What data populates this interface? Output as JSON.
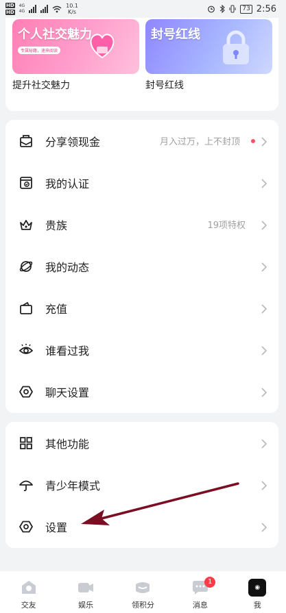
{
  "status_bar": {
    "hd_top": "HD",
    "hd_bottom": "HD",
    "net_top": "4G",
    "net_bottom": "4G",
    "speed_value": "10.1",
    "speed_unit": "K/s",
    "battery": "73",
    "time": "2:56"
  },
  "banners": [
    {
      "title": "个人社交魅力",
      "pill": "专属秘籍，速来阅读",
      "caption": "提升社交魅力"
    },
    {
      "title": "封号红线",
      "caption": "封号红线"
    }
  ],
  "menu_group_1": [
    {
      "icon": "envelope-icon",
      "label": "分享领现金",
      "extra": "月入过万，上不封顶",
      "dot": true
    },
    {
      "icon": "id-check-icon",
      "label": "我的认证",
      "extra": ""
    },
    {
      "icon": "crown-icon",
      "label": "贵族",
      "extra": "19项特权"
    },
    {
      "icon": "planet-icon",
      "label": "我的动态",
      "extra": ""
    },
    {
      "icon": "wallet-icon",
      "label": "充值",
      "extra": ""
    },
    {
      "icon": "eye-icon",
      "label": "谁看过我",
      "extra": ""
    },
    {
      "icon": "hexagon-settings-icon",
      "label": "聊天设置",
      "extra": ""
    }
  ],
  "menu_group_2": [
    {
      "icon": "grid-icon",
      "label": "其他功能"
    },
    {
      "icon": "umbrella-icon",
      "label": "青少年模式"
    },
    {
      "icon": "hexagon-settings-icon",
      "label": "设置"
    }
  ],
  "bottom_nav": [
    {
      "icon": "friends-icon",
      "label": "交友"
    },
    {
      "icon": "camera-icon",
      "label": "娱乐"
    },
    {
      "icon": "points-icon",
      "label": "领积分"
    },
    {
      "icon": "message-icon",
      "label": "消息",
      "badge": "1"
    },
    {
      "icon": "avatar-icon",
      "label": "我"
    }
  ],
  "colors": {
    "accent": "#ff3b48",
    "annotation_arrow": "#7a0e22",
    "banner_pink": "#ff8fc0",
    "banner_purple": "#9d9cff"
  }
}
